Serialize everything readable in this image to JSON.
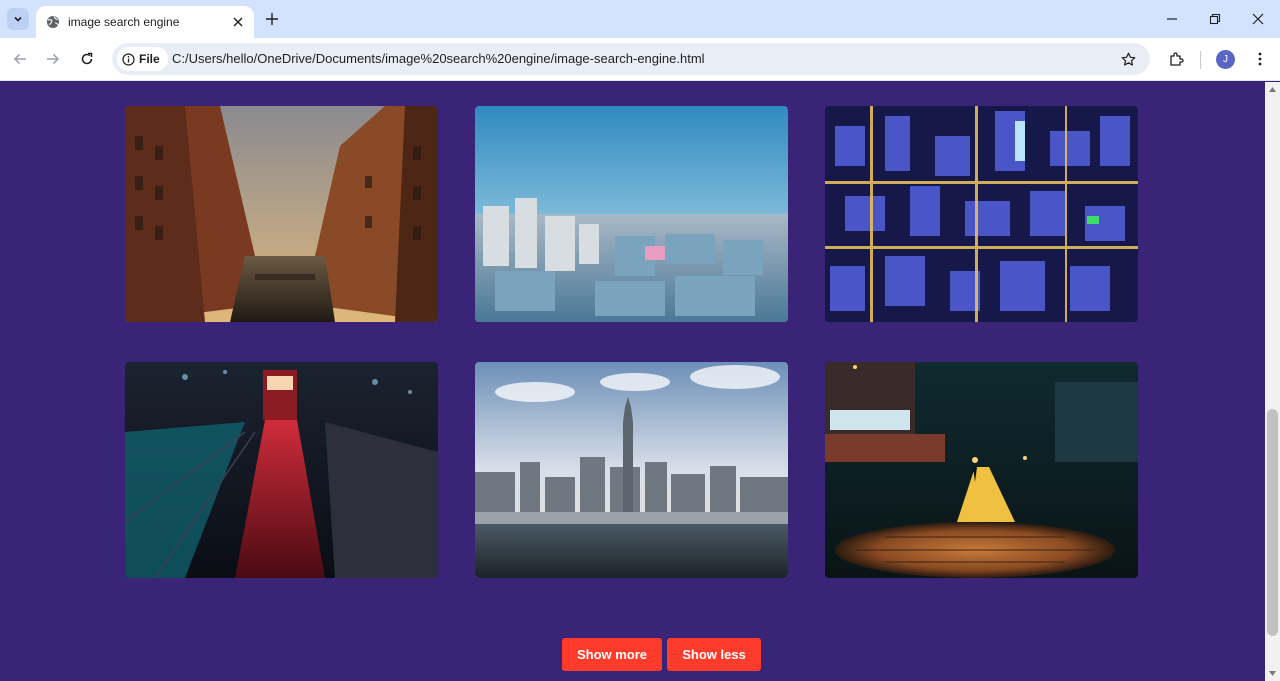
{
  "browser": {
    "tab_title": "image search engine",
    "site_chip": "File",
    "url": "C:/Users/hello/OneDrive/Documents/image%20search%20engine/image-search-engine.html",
    "profile_initial": "J"
  },
  "gallery": {
    "images": [
      {
        "subject": "brick warehouse canal at sunset"
      },
      {
        "subject": "aerial city skyline at dusk"
      },
      {
        "subject": "aerial night city lights"
      },
      {
        "subject": "rainy street with red tram at night"
      },
      {
        "subject": "city skyline over river"
      },
      {
        "subject": "night street with manhole cover"
      }
    ]
  },
  "actions": {
    "show_more": "Show more",
    "show_less": "Show less"
  },
  "colors": {
    "page_background": "#3a2478",
    "button": "#ff3b2b",
    "tabstrip": "#d3e3fd"
  }
}
